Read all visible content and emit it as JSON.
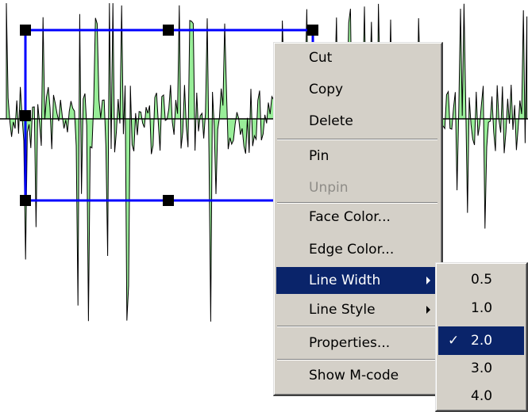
{
  "context_menu": {
    "items": [
      {
        "label": "Cut"
      },
      {
        "label": "Copy"
      },
      {
        "label": "Delete"
      },
      {
        "label": "Pin"
      },
      {
        "label": "Unpin"
      },
      {
        "label": "Face Color..."
      },
      {
        "label": "Edge Color..."
      },
      {
        "label": "Line Width"
      },
      {
        "label": "Line Style"
      },
      {
        "label": "Properties..."
      },
      {
        "label": "Show M-code"
      }
    ],
    "disabled_items": [
      "Unpin"
    ],
    "highlighted_item": "Line Width",
    "submenu_items": [
      "Line Width",
      "Line Style"
    ]
  },
  "line_width_submenu": {
    "options": [
      "0.5",
      "1.0",
      "2.0",
      "3.0",
      "4.0"
    ],
    "checked": "2.0",
    "check_mark": "✓"
  },
  "colors": {
    "signal_fill": "#98ee98",
    "selection_box": "#0000ff",
    "menu_highlight": "#0a246a",
    "menu_face": "#d4d0c8"
  },
  "icons": [
    "submenu-arrow-icon",
    "checkmark-icon",
    "selection-handle-icon"
  ]
}
